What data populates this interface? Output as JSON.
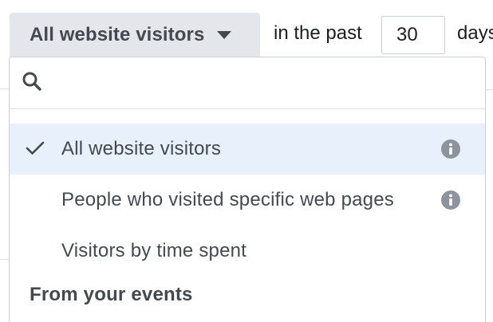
{
  "toolbar": {
    "audience_select_label": "All website visitors",
    "prefix_text": "in the past",
    "days_value": "30",
    "suffix_text": "days"
  },
  "dropdown": {
    "search": {
      "value": "",
      "placeholder": ""
    },
    "options": [
      {
        "label": "All website visitors",
        "selected": true,
        "has_info": true
      },
      {
        "label": "People who visited specific web pages",
        "selected": false,
        "has_info": true
      },
      {
        "label": "Visitors by time spent",
        "selected": false,
        "has_info": false
      }
    ],
    "section_header": "From your events"
  },
  "colors": {
    "selected_row_bg": "#e7f0fb",
    "select_button_bg": "#e4e6eb",
    "text_primary": "#444950",
    "icon_gray": "#8d949e"
  },
  "icons": {
    "search": "search-icon",
    "check": "check-icon",
    "info": "info-icon",
    "caret": "caret-down-icon"
  }
}
